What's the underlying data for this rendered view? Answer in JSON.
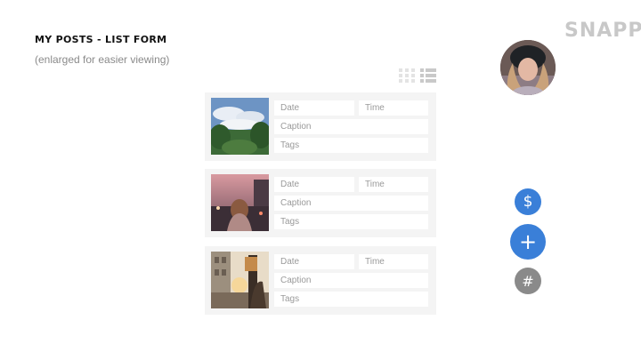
{
  "header": {
    "title": "MY POSTS - LIST FORM",
    "subtitle": "(enlarged for easier viewing)",
    "brand": "SNAPPY"
  },
  "profile": {
    "avatar_icon": "user-avatar"
  },
  "view_toggles": [
    {
      "icon": "grid-view-icon",
      "active": false
    },
    {
      "icon": "list-view-icon",
      "active": true
    }
  ],
  "posts": [
    {
      "thumbnail": "landscape-sky-trees",
      "date_placeholder": "Date",
      "time_placeholder": "Time",
      "caption_placeholder": "Caption",
      "tags_placeholder": "Tags"
    },
    {
      "thumbnail": "woman-city-sunset",
      "date_placeholder": "Date",
      "time_placeholder": "Time",
      "caption_placeholder": "Caption",
      "tags_placeholder": "Tags"
    },
    {
      "thumbnail": "street-sunset-sign",
      "date_placeholder": "Date",
      "time_placeholder": "Time",
      "caption_placeholder": "Caption",
      "tags_placeholder": "Tags"
    }
  ],
  "actions": {
    "dollar": {
      "glyph": "$",
      "icon": "dollar-icon",
      "color": "#3a7fd8"
    },
    "add": {
      "glyph": "+",
      "icon": "plus-icon",
      "color": "#3a7fd8"
    },
    "hash": {
      "glyph": "#",
      "icon": "hashtag-icon",
      "color": "#8a8a8a"
    }
  }
}
